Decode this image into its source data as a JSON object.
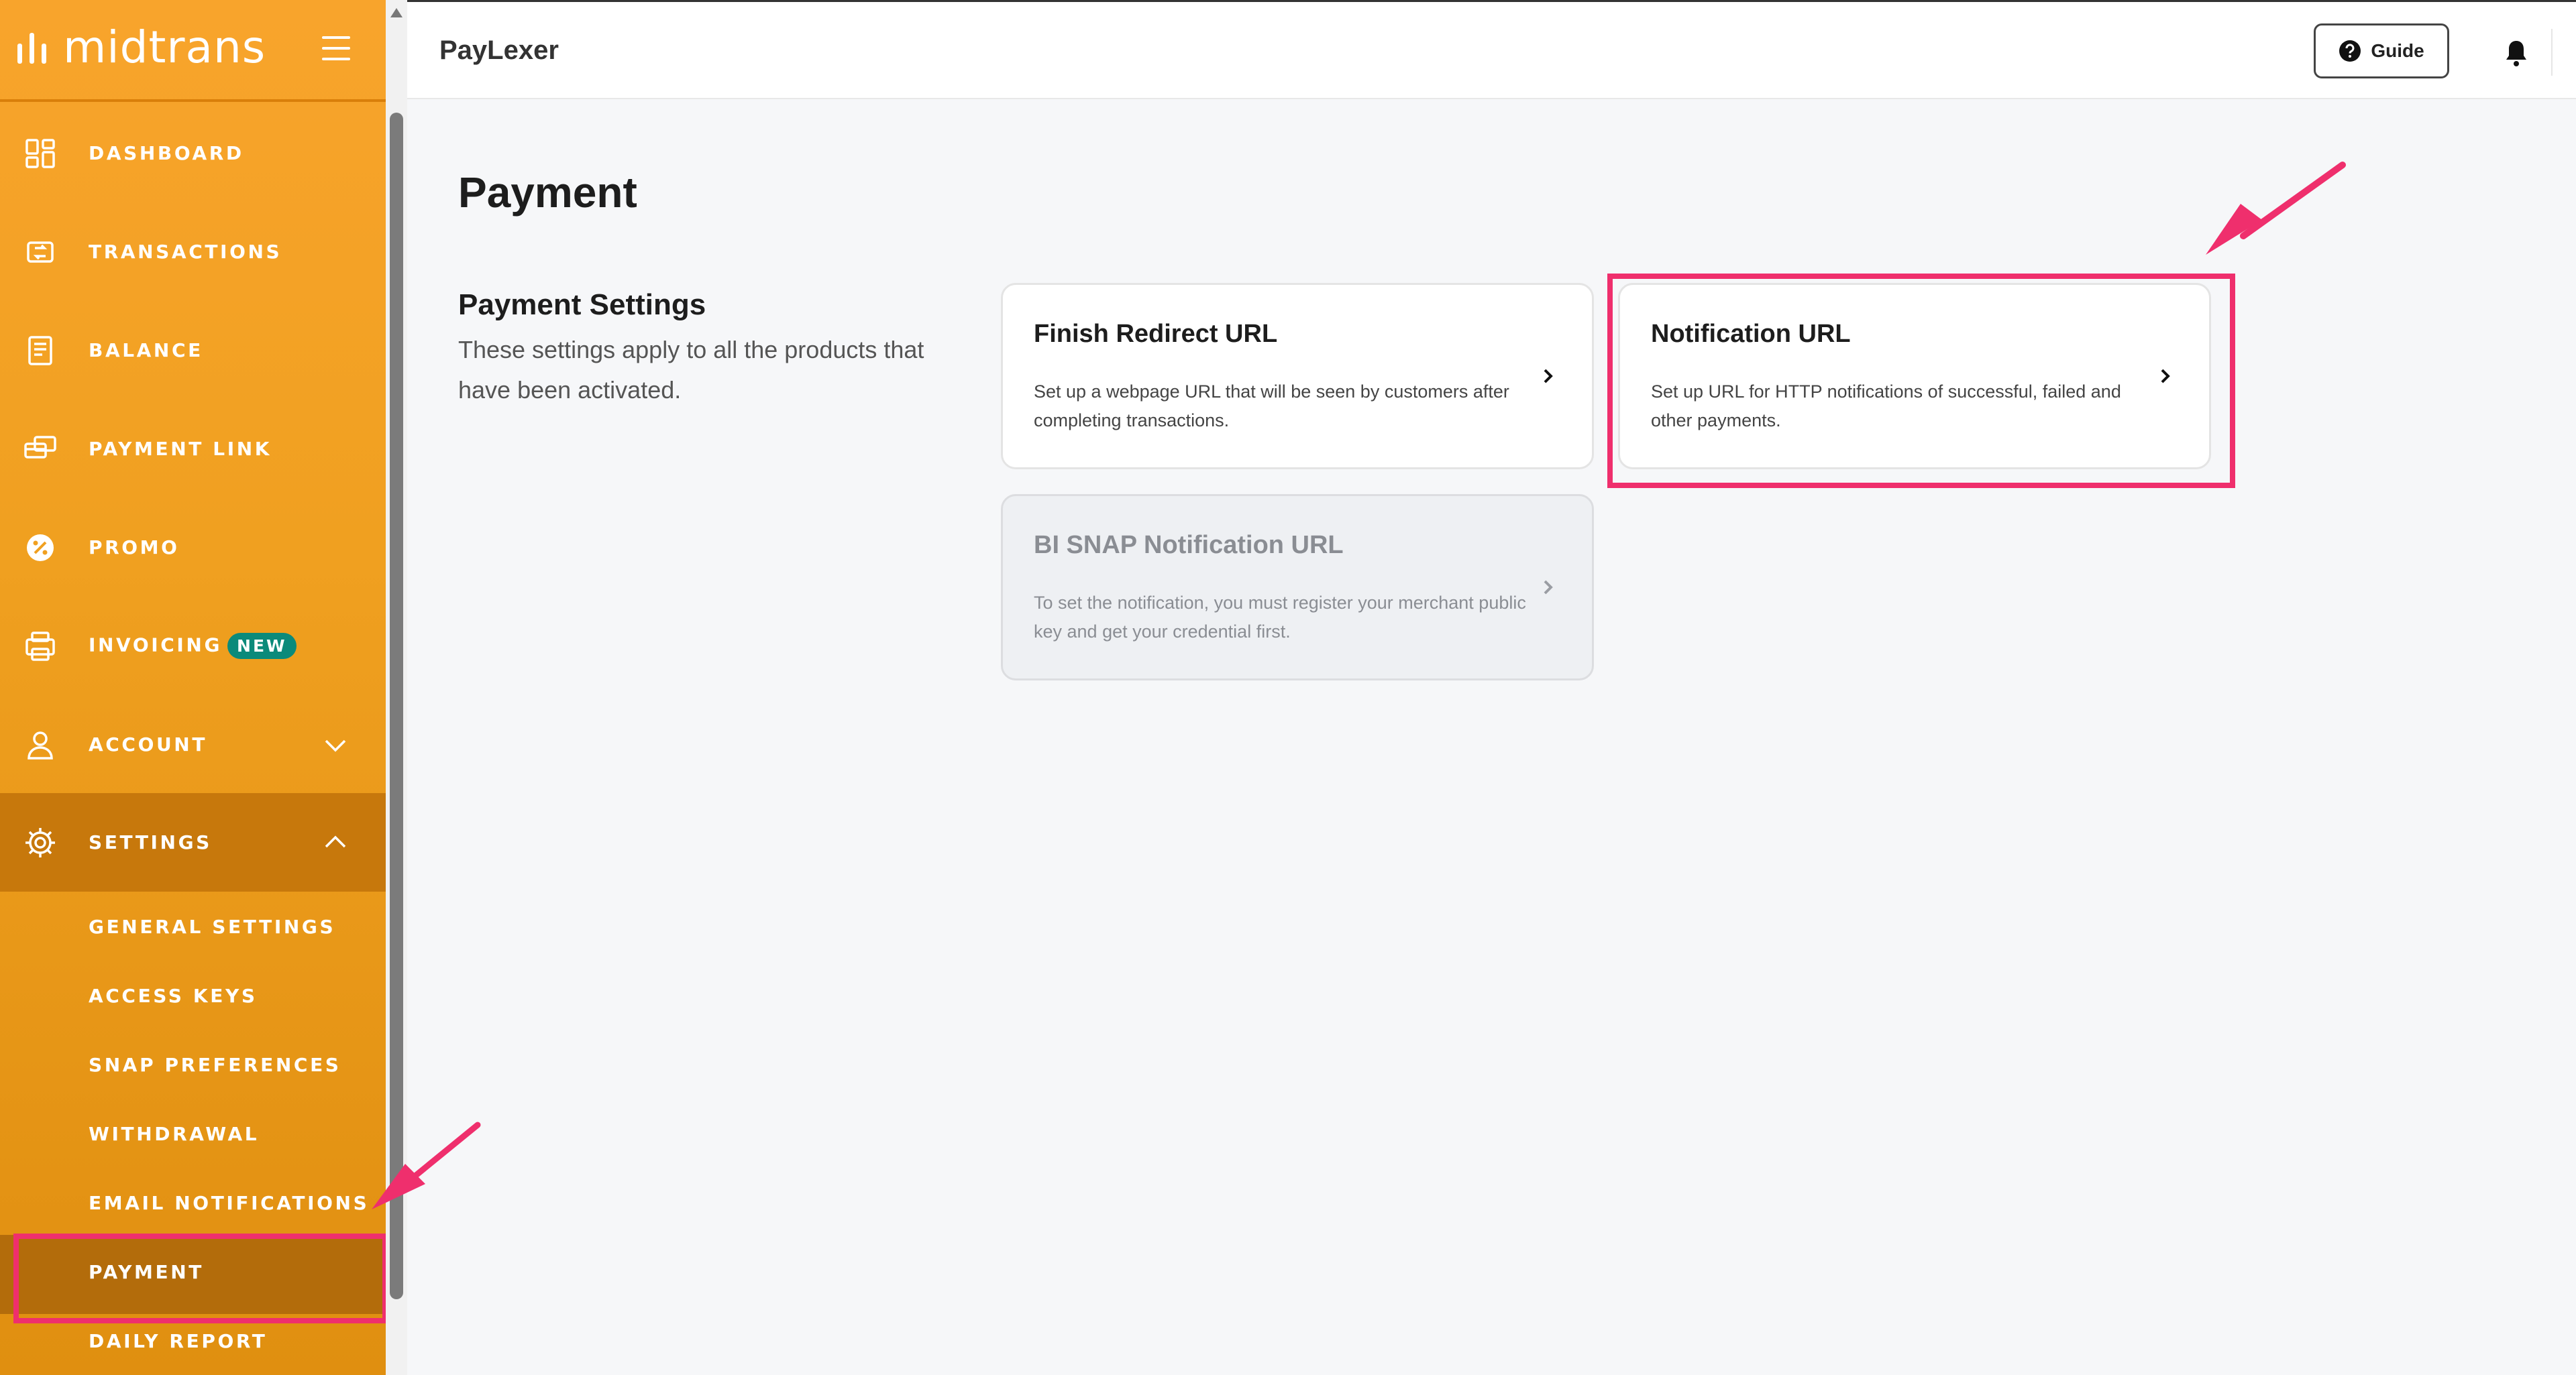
{
  "brand": {
    "logo_text": "midtrans"
  },
  "sidebar": {
    "items": [
      {
        "label": "DASHBOARD",
        "icon": "dashboard-icon"
      },
      {
        "label": "TRANSACTIONS",
        "icon": "transactions-icon"
      },
      {
        "label": "BALANCE",
        "icon": "balance-icon"
      },
      {
        "label": "PAYMENT LINK",
        "icon": "payment-link-icon"
      },
      {
        "label": "PROMO",
        "icon": "promo-icon"
      },
      {
        "label": "INVOICING",
        "badge": "NEW",
        "icon": "invoicing-icon"
      },
      {
        "label": "ACCOUNT",
        "icon": "account-icon"
      },
      {
        "label": "SETTINGS",
        "icon": "gear-icon"
      }
    ],
    "settings_sub": [
      "GENERAL SETTINGS",
      "ACCESS KEYS",
      "SNAP PREFERENCES",
      "WITHDRAWAL",
      "EMAIL NOTIFICATIONS",
      "PAYMENT",
      "DAILY REPORT"
    ]
  },
  "header": {
    "merchant": "PayLexer",
    "guide_label": "Guide"
  },
  "main": {
    "title": "Payment",
    "section": {
      "title": "Payment Settings",
      "description": "These settings apply to all the products that have been activated."
    },
    "cards": [
      {
        "title": "Finish Redirect URL",
        "description": "Set up a webpage URL that will be seen by customers after completing transactions."
      },
      {
        "title": "Notification URL",
        "description": "Set up URL for HTTP notifications of successful, failed and other payments."
      },
      {
        "title": "BI SNAP Notification URL",
        "description": "To set the notification, you must register your merchant public key and get your credential first."
      }
    ]
  },
  "colors": {
    "sidebar_orange": "#f3a125",
    "highlight_pink": "#ef2f6d",
    "badge_teal": "#0b8a7a"
  }
}
